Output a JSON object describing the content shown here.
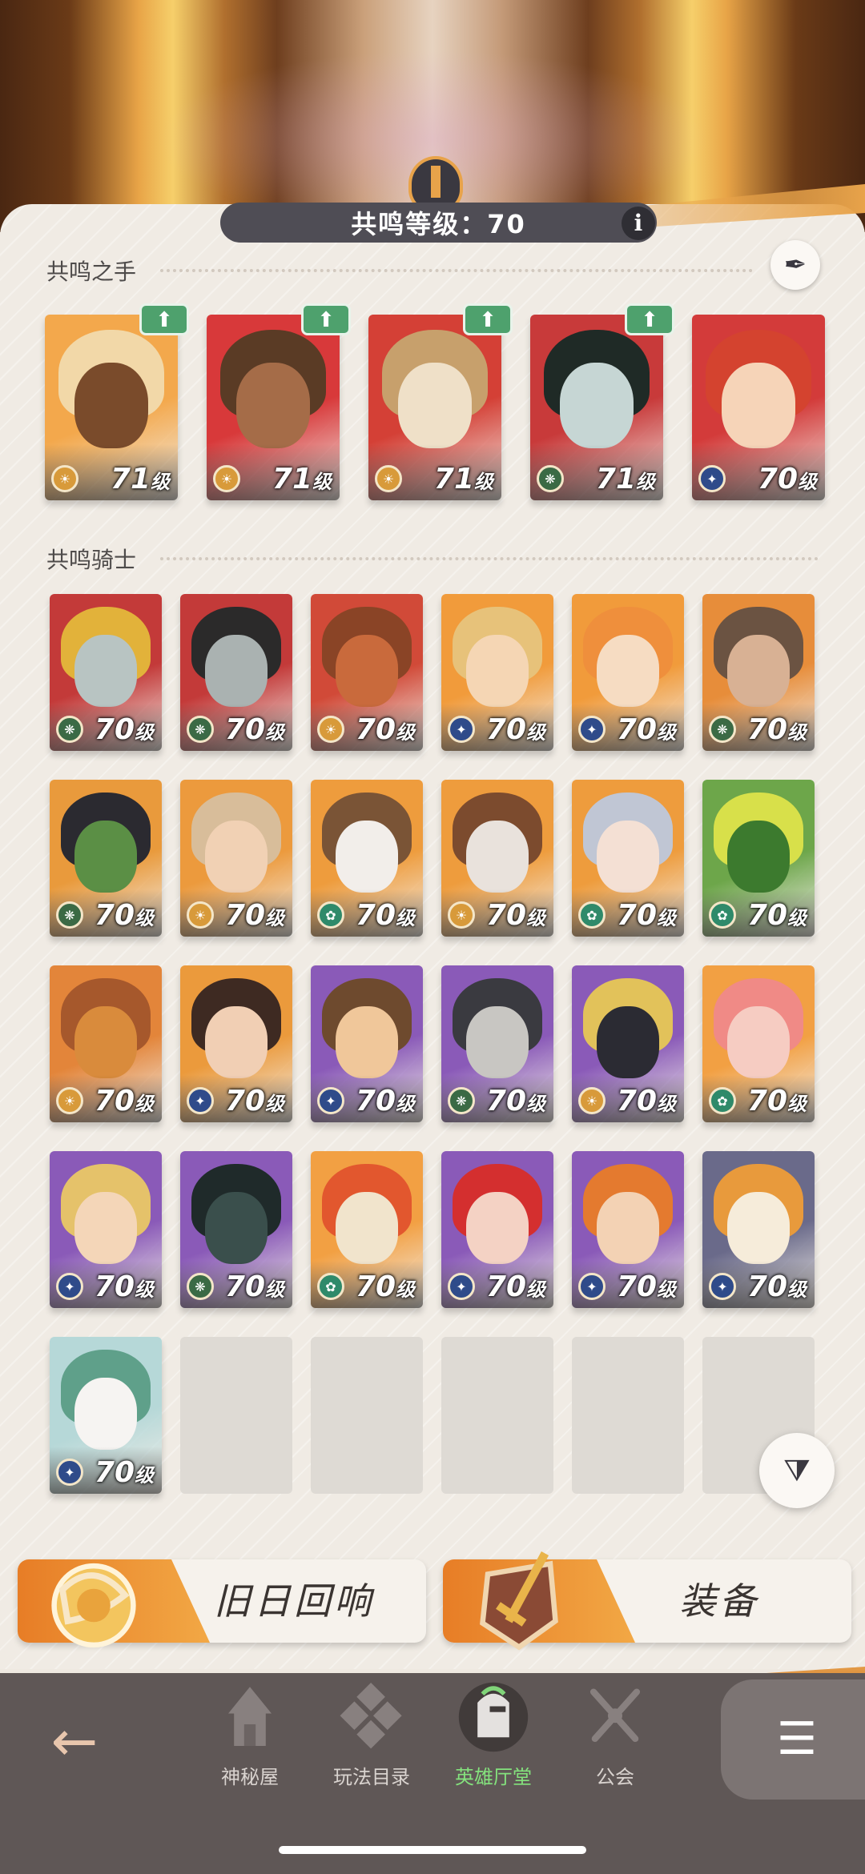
{
  "header": {
    "resonance_label": "共鸣等级：70",
    "info_label": "i"
  },
  "sections": {
    "hands_title": "共鸣之手",
    "knights_title": "共鸣骑士"
  },
  "level_suffix": "级",
  "hands": [
    {
      "level": "71",
      "upgradable": true,
      "faction": "lightbearer",
      "palette": [
        "#f3a84c",
        "#7a4b2b",
        "#f2d8a8"
      ]
    },
    {
      "level": "71",
      "upgradable": true,
      "faction": "lightbearer",
      "palette": [
        "#d8393a",
        "#a56c48",
        "#5a3b25"
      ]
    },
    {
      "level": "71",
      "upgradable": true,
      "faction": "lightbearer",
      "palette": [
        "#d44036",
        "#efe0c8",
        "#c7a06c"
      ]
    },
    {
      "level": "71",
      "upgradable": true,
      "faction": "wilder",
      "palette": [
        "#c83a3a",
        "#c6d6d4",
        "#1f2a26"
      ]
    },
    {
      "level": "70",
      "upgradable": false,
      "faction": "celestial",
      "palette": [
        "#d33b3a",
        "#f6d4b8",
        "#d4432f"
      ]
    }
  ],
  "knights": [
    {
      "level": "70",
      "faction": "wilder",
      "palette": [
        "#c33a39",
        "#b8c4c2",
        "#e2b23a"
      ]
    },
    {
      "level": "70",
      "faction": "wilder",
      "palette": [
        "#c33a39",
        "#aab2b1",
        "#2b2a2a"
      ]
    },
    {
      "level": "70",
      "faction": "lightbearer",
      "palette": [
        "#d14a38",
        "#c96a3c",
        "#8a4426"
      ]
    },
    {
      "level": "70",
      "faction": "celestial",
      "palette": [
        "#f19b3b",
        "#f5d6b4",
        "#e7c27a"
      ]
    },
    {
      "level": "70",
      "faction": "celestial",
      "palette": [
        "#f19b3b",
        "#f6dcc2",
        "#ef8f3c"
      ]
    },
    {
      "level": "70",
      "faction": "wilder",
      "palette": [
        "#e78d3a",
        "#d8b194",
        "#6b5342"
      ]
    },
    {
      "level": "70",
      "faction": "wilder",
      "palette": [
        "#e99a3c",
        "#5b8f45",
        "#2b2a30"
      ]
    },
    {
      "level": "70",
      "faction": "lightbearer",
      "palette": [
        "#ec9a3d",
        "#f1d1b4",
        "#d8bd9a"
      ]
    },
    {
      "level": "70",
      "faction": "graveborn",
      "palette": [
        "#ee9c3d",
        "#f2eeea",
        "#7a5436"
      ]
    },
    {
      "level": "70",
      "faction": "lightbearer",
      "palette": [
        "#ee9c3d",
        "#e9e2dc",
        "#7c4b2e"
      ]
    },
    {
      "level": "70",
      "faction": "graveborn",
      "palette": [
        "#ee9c3d",
        "#f4e0d4",
        "#c0c6d4"
      ]
    },
    {
      "level": "70",
      "faction": "graveborn",
      "palette": [
        "#6da64a",
        "#3c7a2e",
        "#d8e04a"
      ]
    },
    {
      "level": "70",
      "faction": "lightbearer",
      "palette": [
        "#e3853a",
        "#d98b3c",
        "#a6582c"
      ]
    },
    {
      "level": "70",
      "faction": "celestial",
      "palette": [
        "#eb9a3c",
        "#f1cfb4",
        "#3e2a22"
      ]
    },
    {
      "level": "70",
      "faction": "celestial",
      "palette": [
        "#8a5ab8",
        "#f0c79a",
        "#6e4a2e"
      ]
    },
    {
      "level": "70",
      "faction": "wilder",
      "palette": [
        "#8a5ab8",
        "#c8c6c2",
        "#3a3a40"
      ]
    },
    {
      "level": "70",
      "faction": "lightbearer",
      "palette": [
        "#8a5ab8",
        "#2b2b33",
        "#e2c25a"
      ]
    },
    {
      "level": "70",
      "faction": "graveborn",
      "palette": [
        "#f2a043",
        "#f6ccc2",
        "#f08a86"
      ]
    },
    {
      "level": "70",
      "faction": "celestial",
      "palette": [
        "#8a5ab8",
        "#f4d6b8",
        "#e5c26a"
      ]
    },
    {
      "level": "70",
      "faction": "wilder",
      "palette": [
        "#8a5ab8",
        "#3a4f4c",
        "#1f2a2a"
      ]
    },
    {
      "level": "70",
      "faction": "graveborn",
      "palette": [
        "#f2a043",
        "#f1e4cc",
        "#e2572e"
      ]
    },
    {
      "level": "70",
      "faction": "celestial",
      "palette": [
        "#8a5ab8",
        "#f4d2c4",
        "#d42f2f"
      ]
    },
    {
      "level": "70",
      "faction": "celestial",
      "palette": [
        "#8a5ab8",
        "#f3d2b4",
        "#e47a2f"
      ]
    },
    {
      "level": "70",
      "faction": "celestial",
      "palette": [
        "#6a6a8a",
        "#f6ecda",
        "#e89a3c"
      ]
    },
    {
      "level": "70",
      "faction": "celestial",
      "palette": [
        "#b6d8d8",
        "#f6f4f2",
        "#5fa08a"
      ]
    }
  ],
  "empty_slots": 5,
  "faction_colors": {
    "lightbearer": "#d89a3a",
    "wilder": "#3b6a45",
    "graveborn": "#2f8a6a",
    "celestial": "#2f4b8a"
  },
  "buttons": {
    "echo_label": "旧日回响",
    "equipment_label": "装备"
  },
  "nav": {
    "items": [
      {
        "label": "神秘屋",
        "icon": "mystery-house-icon"
      },
      {
        "label": "玩法目录",
        "icon": "game-modes-icon"
      },
      {
        "label": "英雄厅堂",
        "icon": "hero-hall-icon"
      },
      {
        "label": "公会",
        "icon": "guild-icon"
      }
    ],
    "active_index": 2
  },
  "colors": {
    "accent_orange": "#e8a34a",
    "active_green": "#84e27d",
    "nav_bg": "#5f5756"
  }
}
